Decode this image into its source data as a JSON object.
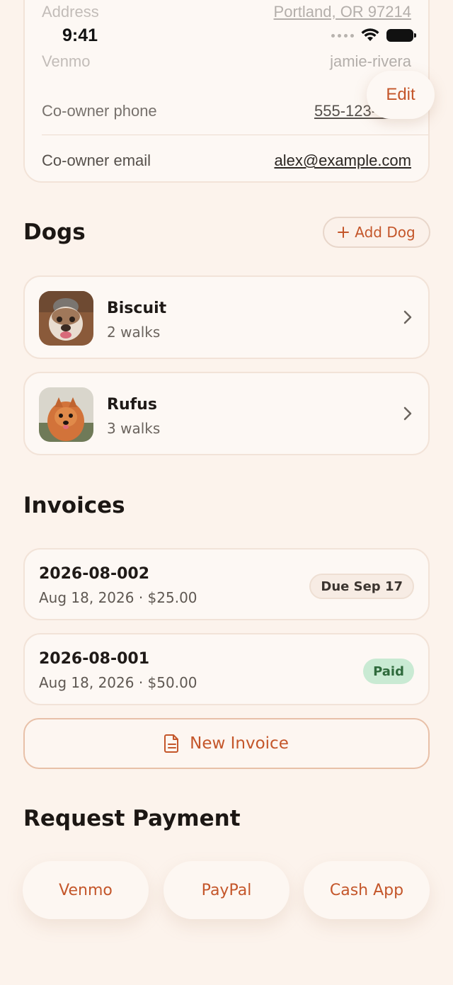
{
  "status_bar": {
    "time": "9:41"
  },
  "owner_card": {
    "rows": [
      {
        "label": "Address",
        "value": "Portland, OR 97214"
      },
      {
        "label": "Venmo",
        "value": "jamie-rivera"
      },
      {
        "label": "Co-owner phone",
        "value": "555-123-4567"
      },
      {
        "label": "Co-owner email",
        "value": "alex@example.com"
      }
    ]
  },
  "header": {
    "edit_label": "Edit"
  },
  "dogs": {
    "title": "Dogs",
    "add_label": "Add Dog",
    "items": [
      {
        "name": "Biscuit",
        "walks": "2 walks"
      },
      {
        "name": "Rufus",
        "walks": "3 walks"
      }
    ]
  },
  "invoices": {
    "title": "Invoices",
    "items": [
      {
        "number": "2026-08-002",
        "meta": "Aug 18, 2026 · $25.00",
        "status": "Due Sep 17"
      },
      {
        "number": "2026-08-001",
        "meta": "Aug 18, 2026 · $50.00",
        "status": "Paid"
      }
    ],
    "new_label": "New Invoice"
  },
  "request_payment": {
    "title": "Request Payment",
    "options": [
      "Venmo",
      "PayPal",
      "Cash App"
    ]
  },
  "colors": {
    "accent": "#c4562a",
    "background": "#fcf3ec",
    "card": "#fdf8f4",
    "paid_badge": "#c9ead3"
  }
}
